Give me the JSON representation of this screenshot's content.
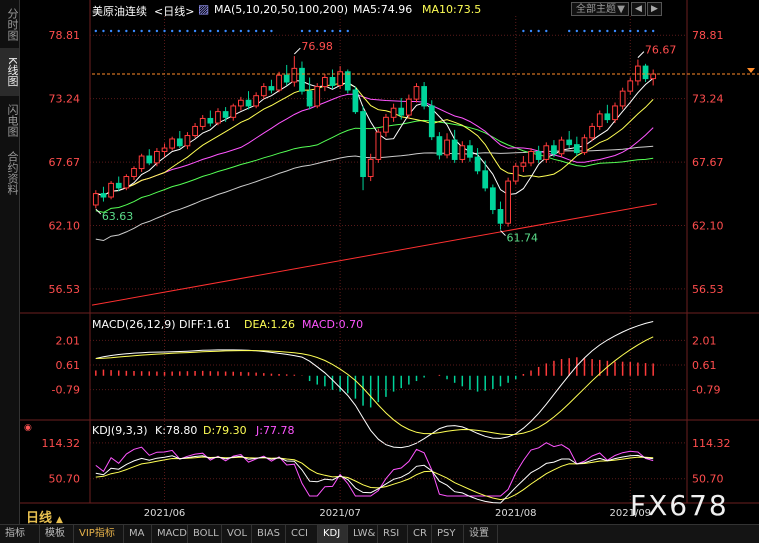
{
  "left_tabs": [
    "分时图",
    "K线图",
    "闪电图",
    "合约资料"
  ],
  "left_tab_active": 1,
  "header": {
    "symbol": "美原油连续",
    "period_tag": "<日线>",
    "ma_label": "MA(5,10,20,50,100,200)",
    "ma5": "MA5:74.96",
    "ma10": "MA10:73.5",
    "theme_dropdown": "全部主题",
    "theme_arrow": "▼",
    "btn_prev": "◀",
    "btn_next": "▶"
  },
  "macd_header": {
    "label": "MACD(26,12,9)",
    "diff": "DIFF:1.61",
    "dea": "DEA:1.26",
    "macd": "MACD:0.70"
  },
  "kdj_header": {
    "label": "KDJ(9,3,3)",
    "k": "K:78.80",
    "d": "D:79.30",
    "j": "J:77.78"
  },
  "price_axis": [
    "78.81",
    "73.24",
    "67.67",
    "62.10",
    "56.53"
  ],
  "macd_axis": [
    "2.01",
    "0.61",
    "-0.79"
  ],
  "kdj_axis": [
    "114.32",
    "50.70"
  ],
  "x_labels": [
    "2021/06",
    "2021/07",
    "2021/08",
    "2021/09"
  ],
  "annotations": {
    "high1": "76.98",
    "high2": "76.67",
    "low1": "63.63",
    "low2": "61.74"
  },
  "period_label": "日线",
  "period_arrow": "▲",
  "bottom_tabs": [
    "指标",
    "模板",
    "VIP指标",
    "MA",
    "MACD",
    "BOLL",
    "VOL",
    "BIAS",
    "CCI",
    "KDJ",
    "LW&",
    "RSI",
    "CR",
    "PSY",
    "设置"
  ],
  "bottom_active": "KDJ",
  "watermark": "FX678",
  "colors": {
    "up": "#ff3b3b",
    "down": "#00d49a",
    "ma5": "#ffffff",
    "ma10": "#ffff55",
    "ma20": "#ff55ff",
    "ma50": "#55ff55",
    "ma100": "#cccccc",
    "ma200": "#ff3030",
    "axis_red": "#ff4d4d",
    "grid": "#5a1a1a"
  },
  "chart_data": {
    "type": "candlestick",
    "title": "美原油连续 日线",
    "ylim": [
      54.5,
      80.5
    ],
    "candles": [
      [
        63.9,
        65.2,
        63.6,
        64.9
      ],
      [
        64.9,
        65.5,
        64.2,
        64.6
      ],
      [
        64.6,
        66.0,
        64.4,
        65.8
      ],
      [
        65.8,
        66.4,
        65.1,
        65.4
      ],
      [
        65.4,
        66.6,
        65.2,
        66.4
      ],
      [
        66.4,
        67.3,
        66.1,
        67.1
      ],
      [
        67.1,
        68.4,
        66.8,
        68.2
      ],
      [
        68.2,
        68.8,
        67.4,
        67.6
      ],
      [
        67.6,
        68.9,
        67.3,
        68.6
      ],
      [
        68.6,
        69.3,
        68.1,
        68.9
      ],
      [
        68.9,
        69.9,
        68.7,
        69.7
      ],
      [
        69.7,
        70.4,
        68.9,
        69.1
      ],
      [
        69.1,
        70.3,
        68.8,
        70.0
      ],
      [
        70.0,
        71.1,
        69.8,
        70.8
      ],
      [
        70.8,
        71.8,
        70.5,
        71.5
      ],
      [
        71.5,
        72.2,
        70.8,
        71.1
      ],
      [
        71.1,
        72.4,
        70.9,
        72.1
      ],
      [
        72.1,
        72.5,
        71.2,
        71.6
      ],
      [
        71.6,
        72.8,
        71.3,
        72.6
      ],
      [
        72.6,
        73.4,
        72.2,
        73.1
      ],
      [
        73.1,
        73.9,
        72.3,
        72.6
      ],
      [
        72.6,
        73.8,
        72.4,
        73.5
      ],
      [
        73.5,
        74.6,
        73.2,
        74.3
      ],
      [
        74.3,
        74.9,
        73.7,
        74.0
      ],
      [
        74.0,
        75.6,
        73.8,
        75.3
      ],
      [
        75.3,
        76.2,
        74.4,
        74.7
      ],
      [
        74.7,
        76.98,
        74.3,
        75.9
      ],
      [
        75.9,
        76.5,
        73.6,
        73.9
      ],
      [
        73.9,
        75.1,
        72.3,
        72.6
      ],
      [
        72.6,
        74.6,
        72.4,
        74.3
      ],
      [
        74.3,
        75.4,
        73.9,
        75.1
      ],
      [
        75.1,
        75.8,
        74.1,
        74.4
      ],
      [
        74.4,
        76.1,
        74.1,
        75.6
      ],
      [
        75.6,
        75.8,
        73.7,
        74.0
      ],
      [
        74.0,
        74.3,
        71.9,
        72.1
      ],
      [
        72.1,
        72.6,
        65.2,
        66.4
      ],
      [
        66.4,
        68.4,
        66.0,
        67.9
      ],
      [
        67.9,
        70.6,
        67.6,
        70.3
      ],
      [
        70.3,
        71.9,
        69.9,
        71.6
      ],
      [
        71.6,
        72.8,
        71.2,
        72.4
      ],
      [
        72.4,
        73.3,
        71.4,
        71.8
      ],
      [
        71.8,
        73.6,
        71.5,
        73.2
      ],
      [
        73.2,
        74.6,
        72.9,
        74.3
      ],
      [
        74.3,
        74.7,
        72.3,
        72.6
      ],
      [
        72.6,
        73.1,
        69.6,
        69.9
      ],
      [
        69.9,
        70.3,
        67.9,
        68.3
      ],
      [
        68.3,
        70.2,
        68.0,
        69.6
      ],
      [
        69.6,
        70.5,
        67.6,
        67.9
      ],
      [
        67.9,
        69.5,
        67.6,
        69.1
      ],
      [
        69.1,
        69.6,
        67.7,
        68.1
      ],
      [
        68.1,
        68.9,
        66.6,
        66.9
      ],
      [
        66.9,
        67.8,
        65.1,
        65.4
      ],
      [
        65.4,
        65.7,
        63.1,
        63.5
      ],
      [
        63.5,
        64.2,
        61.74,
        62.3
      ],
      [
        62.3,
        66.3,
        62.0,
        66.0
      ],
      [
        66.0,
        67.6,
        65.7,
        67.3
      ],
      [
        67.3,
        68.2,
        66.8,
        67.6
      ],
      [
        67.6,
        68.9,
        67.3,
        68.6
      ],
      [
        68.6,
        69.1,
        67.6,
        67.9
      ],
      [
        67.9,
        69.4,
        67.6,
        69.1
      ],
      [
        69.1,
        69.6,
        68.1,
        68.4
      ],
      [
        68.4,
        69.9,
        68.1,
        69.6
      ],
      [
        69.6,
        70.4,
        68.9,
        69.2
      ],
      [
        69.2,
        69.9,
        68.2,
        68.5
      ],
      [
        68.5,
        70.1,
        68.3,
        69.8
      ],
      [
        69.8,
        71.1,
        69.5,
        70.8
      ],
      [
        70.8,
        72.2,
        70.5,
        71.9
      ],
      [
        71.9,
        72.7,
        71.1,
        71.4
      ],
      [
        71.4,
        72.9,
        71.1,
        72.6
      ],
      [
        72.6,
        74.2,
        72.3,
        73.9
      ],
      [
        73.9,
        75.1,
        73.6,
        74.8
      ],
      [
        74.8,
        76.67,
        74.4,
        76.1
      ],
      [
        76.1,
        76.3,
        74.7,
        75.0
      ],
      [
        75.0,
        75.8,
        74.4,
        75.4
      ]
    ],
    "ma200": {
      "start": 55.1,
      "end": 64.0
    },
    "markers_high": [
      {
        "index": 26,
        "value": 76.98
      },
      {
        "index": 71,
        "value": 76.67
      }
    ],
    "markers_low": [
      {
        "index": 0,
        "value": 63.63
      },
      {
        "index": 53,
        "value": 61.74
      }
    ],
    "last_price": 75.4,
    "macd": {
      "ylim": [
        -2.4,
        2.6
      ],
      "bars": [
        0.3,
        0.35,
        0.32,
        0.3,
        0.28,
        0.27,
        0.26,
        0.25,
        0.24,
        0.22,
        0.24,
        0.25,
        0.26,
        0.27,
        0.28,
        0.26,
        0.25,
        0.24,
        0.23,
        0.22,
        0.2,
        0.18,
        0.15,
        0.12,
        0.1,
        0.08,
        0.06,
        0.02,
        -0.3,
        -0.5,
        -0.6,
        -0.8,
        -0.9,
        -1.0,
        -1.3,
        -1.7,
        -1.8,
        -1.5,
        -1.2,
        -0.9,
        -0.7,
        -0.5,
        -0.3,
        -0.1,
        0.0,
        0.05,
        -0.2,
        -0.4,
        -0.6,
        -0.8,
        -0.9,
        -0.85,
        -0.75,
        -0.6,
        -0.4,
        -0.2,
        0.1,
        0.3,
        0.5,
        0.7,
        0.85,
        0.95,
        1.0,
        1.05,
        1.0,
        0.95,
        0.9,
        0.85,
        0.8,
        0.8,
        0.78,
        0.75,
        0.72,
        0.7
      ]
    },
    "kdj": {
      "ylim": [
        20,
        130
      ]
    }
  }
}
